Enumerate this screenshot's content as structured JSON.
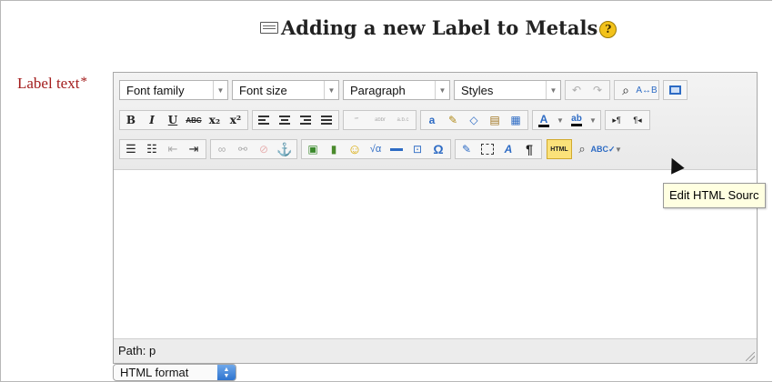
{
  "page": {
    "title": "Adding a new Label to Metals",
    "help_icon": "?"
  },
  "form": {
    "label_text": "Label text",
    "required_marker": "*",
    "format_select": "HTML format"
  },
  "toolbar": {
    "font_family": "Font family",
    "font_size": "Font size",
    "paragraph": "Paragraph",
    "styles": "Styles",
    "bold": "B",
    "italic": "I",
    "underline": "U",
    "strike": "ABC",
    "subscript": "x₂",
    "superscript": "x²",
    "html_button": "HTML",
    "omega": "Ω",
    "pilcrow": "¶"
  },
  "editor": {
    "path_label": "Path: p",
    "tooltip": "Edit HTML Sourc"
  },
  "colors": {
    "label_red": "#a31c1c",
    "toolbar_bg": "#ececec",
    "html_button_yellow": "#fbe27a",
    "tooltip_bg": "#ffffe1"
  }
}
